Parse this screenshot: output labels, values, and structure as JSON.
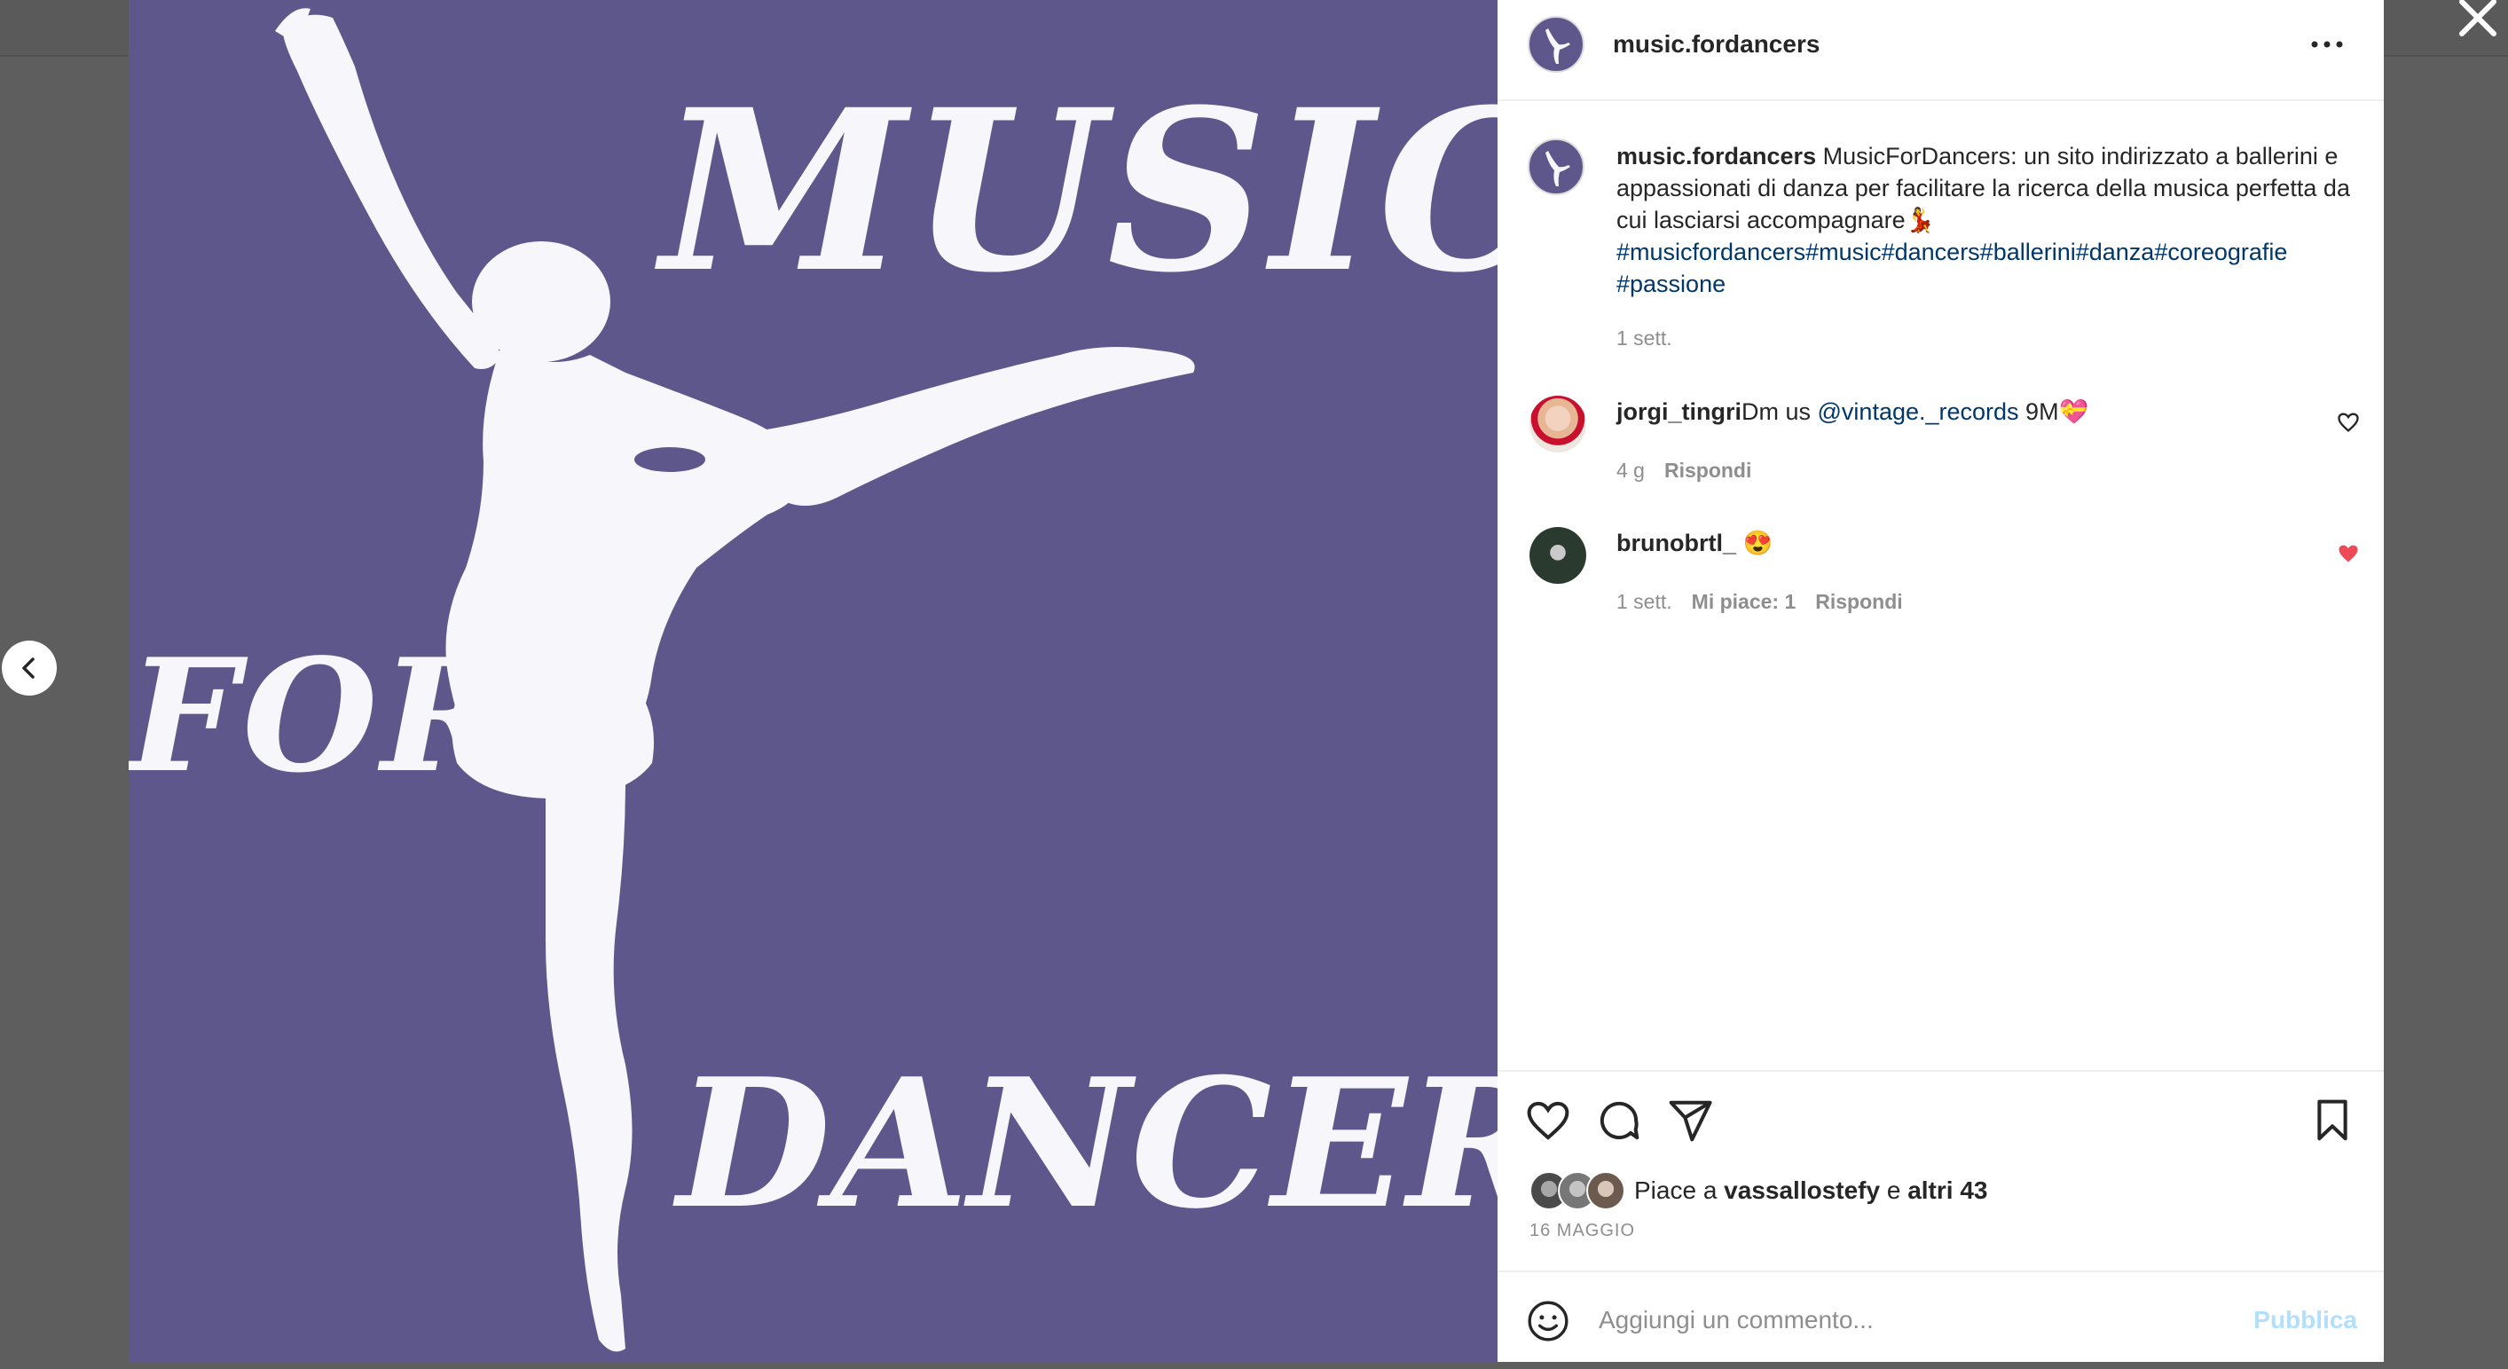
{
  "post": {
    "image_text": {
      "line1": "MUSIC",
      "line2": "FOR",
      "line3": "DANCERS"
    },
    "image_background": "#5e578c",
    "image_foreground": "#f7f6fa"
  },
  "header": {
    "username": "music.fordancers",
    "more_icon": "more-horizontal-icon"
  },
  "caption": {
    "username": "music.fordancers",
    "text": "MusicForDancers: un sito indirizzato a ballerini e appassionati di danza per facilitare la ricerca della musica perfetta da cui lasciarsi accompagnare💃",
    "hashtags": "#musicfordancers#music#dancers#ballerini#danza#coreografie #passione",
    "time": "1 sett."
  },
  "comments": [
    {
      "username": "jorgi_tingri",
      "text_before": "Dm us ",
      "mention": "@vintage._records",
      "text_after": " 9M💝",
      "time": "4 g",
      "likes": "",
      "reply": "Rispondi",
      "liked": false
    },
    {
      "username": "brunobrtl_",
      "text_before": " 😍",
      "mention": "",
      "text_after": "",
      "time": "1 sett.",
      "likes": "Mi piace: 1",
      "reply": "Rispondi",
      "liked": true
    }
  ],
  "likes": {
    "prefix": "Piace a ",
    "user": "vassallostefy",
    "conj": " e ",
    "others": "altri 43"
  },
  "date": "16 MAGGIO",
  "add_comment": {
    "placeholder": "Aggiungi un commento...",
    "publish": "Pubblica"
  },
  "colors": {
    "link": "#00376b",
    "muted": "#8e8e8e",
    "heart_liked": "#ed4956",
    "publish_disabled": "#b2dffc",
    "overlay": "#5e5e5e"
  }
}
